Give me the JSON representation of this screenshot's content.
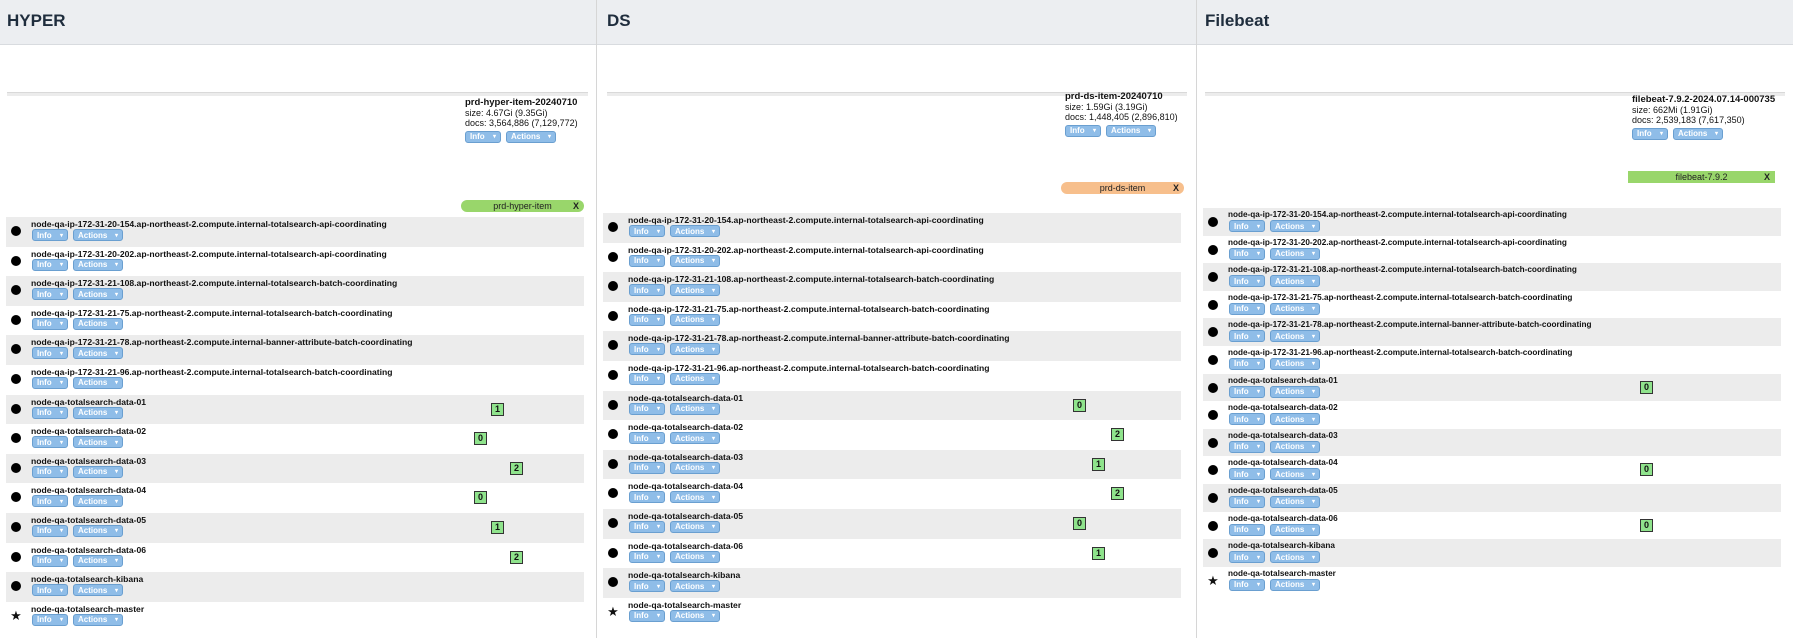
{
  "panels": [
    {
      "title": "HYPER",
      "index": {
        "name": "prd-hyper-item-20240710",
        "size": "size: 4.67Gi (9.35Gi)",
        "docs": "docs: 3,564,886 (7,129,772)"
      },
      "alias": {
        "label": "prd-hyper-item",
        "close": "X",
        "color": "#99d66b"
      },
      "nodes": [
        {
          "name": "node-qa-ip-172-31-20-154.ap-northeast-2.compute.internal-totalsearch-api-coordinating",
          "icon": "dot",
          "shard": null
        },
        {
          "name": "node-qa-ip-172-31-20-202.ap-northeast-2.compute.internal-totalsearch-api-coordinating",
          "icon": "dot",
          "shard": null
        },
        {
          "name": "node-qa-ip-172-31-21-108.ap-northeast-2.compute.internal-totalsearch-batch-coordinating",
          "icon": "dot",
          "shard": null
        },
        {
          "name": "node-qa-ip-172-31-21-75.ap-northeast-2.compute.internal-totalsearch-batch-coordinating",
          "icon": "dot",
          "shard": null
        },
        {
          "name": "node-qa-ip-172-31-21-78.ap-northeast-2.compute.internal-banner-attribute-batch-coordinating",
          "icon": "dot",
          "shard": null
        },
        {
          "name": "node-qa-ip-172-31-21-96.ap-northeast-2.compute.internal-totalsearch-batch-coordinating",
          "icon": "dot",
          "shard": null
        },
        {
          "name": "node-qa-totalsearch-data-01",
          "icon": "dot",
          "shard": "1"
        },
        {
          "name": "node-qa-totalsearch-data-02",
          "icon": "dot",
          "shard": "0"
        },
        {
          "name": "node-qa-totalsearch-data-03",
          "icon": "dot",
          "shard": "2"
        },
        {
          "name": "node-qa-totalsearch-data-04",
          "icon": "dot",
          "shard": "0"
        },
        {
          "name": "node-qa-totalsearch-data-05",
          "icon": "dot",
          "shard": "1"
        },
        {
          "name": "node-qa-totalsearch-data-06",
          "icon": "dot",
          "shard": "2"
        },
        {
          "name": "node-qa-totalsearch-kibana",
          "icon": "dot",
          "shard": null
        },
        {
          "name": "node-qa-totalsearch-master",
          "icon": "star",
          "shard": null
        }
      ]
    },
    {
      "title": "DS",
      "index": {
        "name": "prd-ds-item-20240710",
        "size": "size: 1.59Gi (3.19Gi)",
        "docs": "docs: 1,448,405 (2,896,810)"
      },
      "alias": {
        "label": "prd-ds-item",
        "close": "X",
        "color": "#f7bf8c"
      },
      "nodes": [
        {
          "name": "node-qa-ip-172-31-20-154.ap-northeast-2.compute.internal-totalsearch-api-coordinating",
          "icon": "dot",
          "shard": null
        },
        {
          "name": "node-qa-ip-172-31-20-202.ap-northeast-2.compute.internal-totalsearch-api-coordinating",
          "icon": "dot",
          "shard": null
        },
        {
          "name": "node-qa-ip-172-31-21-108.ap-northeast-2.compute.internal-totalsearch-batch-coordinating",
          "icon": "dot",
          "shard": null
        },
        {
          "name": "node-qa-ip-172-31-21-75.ap-northeast-2.compute.internal-totalsearch-batch-coordinating",
          "icon": "dot",
          "shard": null
        },
        {
          "name": "node-qa-ip-172-31-21-78.ap-northeast-2.compute.internal-banner-attribute-batch-coordinating",
          "icon": "dot",
          "shard": null
        },
        {
          "name": "node-qa-ip-172-31-21-96.ap-northeast-2.compute.internal-totalsearch-batch-coordinating",
          "icon": "dot",
          "shard": null
        },
        {
          "name": "node-qa-totalsearch-data-01",
          "icon": "dot",
          "shard": "0"
        },
        {
          "name": "node-qa-totalsearch-data-02",
          "icon": "dot",
          "shard": "2"
        },
        {
          "name": "node-qa-totalsearch-data-03",
          "icon": "dot",
          "shard": "1"
        },
        {
          "name": "node-qa-totalsearch-data-04",
          "icon": "dot",
          "shard": "2"
        },
        {
          "name": "node-qa-totalsearch-data-05",
          "icon": "dot",
          "shard": "0"
        },
        {
          "name": "node-qa-totalsearch-data-06",
          "icon": "dot",
          "shard": "1"
        },
        {
          "name": "node-qa-totalsearch-kibana",
          "icon": "dot",
          "shard": null
        },
        {
          "name": "node-qa-totalsearch-master",
          "icon": "star",
          "shard": null
        }
      ]
    },
    {
      "title": "Filebeat",
      "index": {
        "name": "filebeat-7.9.2-2024.07.14-000735",
        "size": "size: 662Mi (1.91Gi)",
        "docs": "docs: 2,539,183 (7,617,350)"
      },
      "alias": {
        "label": "filebeat-7.9.2",
        "close": "X",
        "color": "#99d66b"
      },
      "nodes": [
        {
          "name": "node-qa-ip-172-31-20-154.ap-northeast-2.compute.internal-totalsearch-api-coordinating",
          "icon": "dot",
          "shard": null
        },
        {
          "name": "node-qa-ip-172-31-20-202.ap-northeast-2.compute.internal-totalsearch-api-coordinating",
          "icon": "dot",
          "shard": null
        },
        {
          "name": "node-qa-ip-172-31-21-108.ap-northeast-2.compute.internal-totalsearch-batch-coordinating",
          "icon": "dot",
          "shard": null
        },
        {
          "name": "node-qa-ip-172-31-21-75.ap-northeast-2.compute.internal-totalsearch-batch-coordinating",
          "icon": "dot",
          "shard": null
        },
        {
          "name": "node-qa-ip-172-31-21-78.ap-northeast-2.compute.internal-banner-attribute-batch-coordinating",
          "icon": "dot",
          "shard": null
        },
        {
          "name": "node-qa-ip-172-31-21-96.ap-northeast-2.compute.internal-totalsearch-batch-coordinating",
          "icon": "dot",
          "shard": null
        },
        {
          "name": "node-qa-totalsearch-data-01",
          "icon": "dot",
          "shard": "0"
        },
        {
          "name": "node-qa-totalsearch-data-02",
          "icon": "dot",
          "shard": null
        },
        {
          "name": "node-qa-totalsearch-data-03",
          "icon": "dot",
          "shard": null
        },
        {
          "name": "node-qa-totalsearch-data-04",
          "icon": "dot",
          "shard": "0"
        },
        {
          "name": "node-qa-totalsearch-data-05",
          "icon": "dot",
          "shard": null
        },
        {
          "name": "node-qa-totalsearch-data-06",
          "icon": "dot",
          "shard": "0"
        },
        {
          "name": "node-qa-totalsearch-kibana",
          "icon": "dot",
          "shard": null
        },
        {
          "name": "node-qa-totalsearch-master",
          "icon": "star",
          "shard": null
        }
      ]
    }
  ],
  "buttons": {
    "info": "Info",
    "actions": "Actions",
    "caret": "▾"
  },
  "colors": {
    "shard_fill": "#8fe38c",
    "button": "#8fbde8",
    "row_shade": "#ececec"
  }
}
